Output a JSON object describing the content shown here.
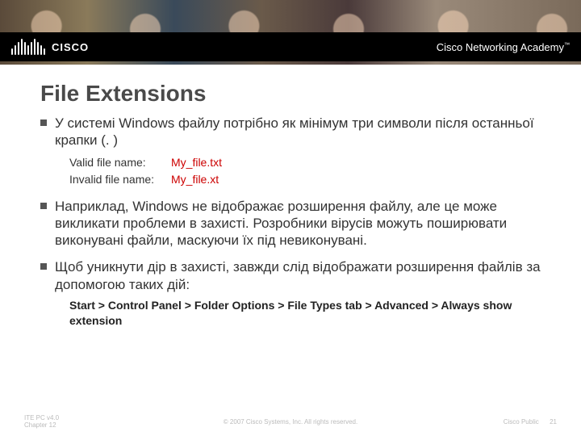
{
  "header": {
    "logo_text": "CISCO",
    "academy": "Cisco Networking Academy",
    "tm": "™"
  },
  "title": "File Extensions",
  "bullets": {
    "b1": "У системі Windows файлу потрібно як мінімум три символи після останньої крапки (. )",
    "b1_valid_label": "Valid file name:",
    "b1_valid_value": "My_file.txt",
    "b1_invalid_label": "Invalid file name:",
    "b1_invalid_value": "My_file.xt",
    "b2": "Наприклад, Windows не відображає розширення файлу, але це може викликати проблеми в захисті. Розробники вірусів можуть поширювати виконувані файли, маскуючи їх під невиконувані.",
    "b3": "Щоб уникнути дір в захисті, завжди слід відображати розширення файлів за допомогою таких дій:",
    "b3_path": "Start > Control Panel > Folder Options > File Types tab > Advanced > Always show extension"
  },
  "footer": {
    "course": "ITE PC v4.0",
    "chapter": "Chapter 12",
    "copyright": "© 2007 Cisco Systems, Inc. All rights reserved.",
    "label": "Cisco Public",
    "page": "21"
  }
}
